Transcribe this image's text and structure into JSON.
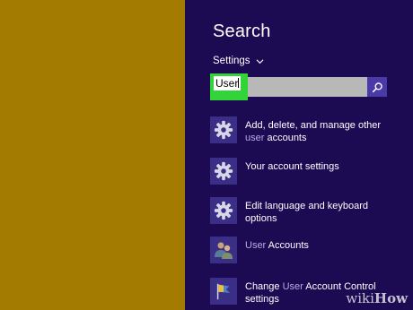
{
  "charm": {
    "title": "Search",
    "scope": "Settings",
    "search": {
      "value": "User"
    }
  },
  "results": [
    {
      "icon": "gear-icon",
      "pre": "Add, delete, and manage other",
      "hl": "user",
      "post": " accounts"
    },
    {
      "icon": "gear-icon",
      "pre": "Your account settings",
      "hl": "",
      "post": ""
    },
    {
      "icon": "gear-icon",
      "pre": "Edit language and keyboard options",
      "hl": "",
      "post": ""
    },
    {
      "icon": "user-accounts-icon",
      "pre": "",
      "hl": "User",
      "post": " Accounts"
    },
    {
      "icon": "uac-flag-icon",
      "pre": "Change ",
      "hl": "User",
      "post": " Account Control settings"
    }
  ],
  "watermark": {
    "wiki": "wiki",
    "how": "How"
  },
  "colors": {
    "desktop": "#a37b00",
    "charm_bg": "#1c0a52",
    "icon_bg": "#3b2e86",
    "highlight_green": "#33d43a",
    "search_button": "#4a3aa8"
  }
}
